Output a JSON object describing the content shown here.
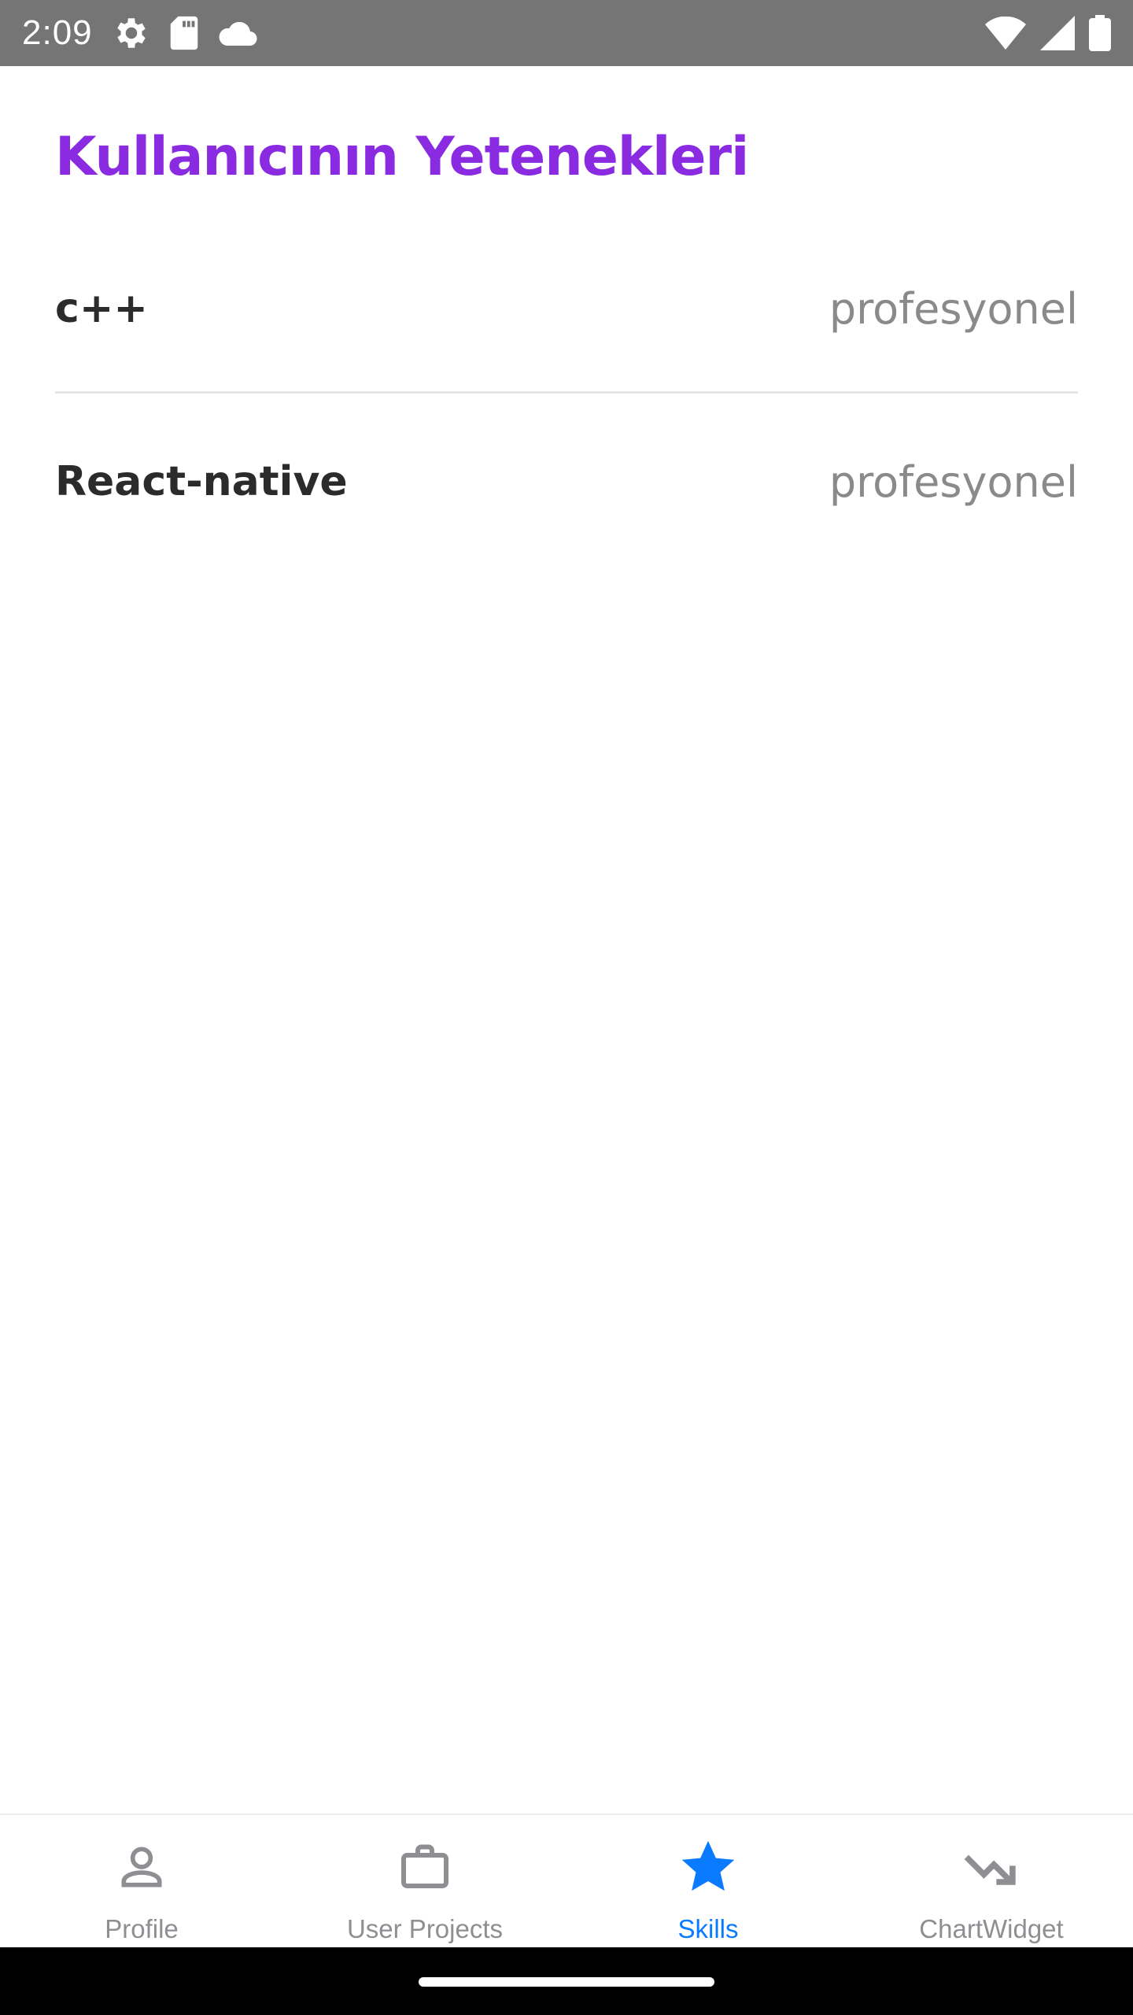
{
  "status_bar": {
    "time": "2:09",
    "left_icons": [
      "settings-gear-icon",
      "sd-card-icon",
      "cloud-icon"
    ],
    "right_icons": [
      "wifi-icon",
      "signal-icon",
      "battery-icon"
    ]
  },
  "page": {
    "title": "Kullanıcının Yetenekleri"
  },
  "skills": [
    {
      "name": "c++",
      "level": "profesyonel"
    },
    {
      "name": "React-native",
      "level": "profesyonel"
    }
  ],
  "bottom_nav": {
    "active": "Skills",
    "active_color": "#0a7aff",
    "inactive_color": "#8e8e93",
    "tabs": [
      {
        "label": "Profile",
        "icon": "person-icon"
      },
      {
        "label": "User Projects",
        "icon": "briefcase-icon"
      },
      {
        "label": "Skills",
        "icon": "star-icon"
      },
      {
        "label": "ChartWidget",
        "icon": "trending-down-icon"
      }
    ]
  },
  "colors": {
    "title": "#8a2be2",
    "status_bar": "#757575"
  }
}
